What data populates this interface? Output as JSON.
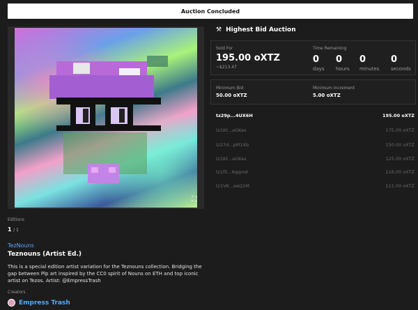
{
  "banner": {
    "label": "Auction Concluded"
  },
  "auction": {
    "title": "Highest Bid Auction",
    "icon": "gavel-icon",
    "sold_label": "Sold For",
    "sold_value": "195.00 oXTZ",
    "sold_usd": "~$213.47",
    "time_label": "Time Remaining",
    "time": [
      {
        "value": "0",
        "unit": "days"
      },
      {
        "value": "0",
        "unit": "hours"
      },
      {
        "value": "0",
        "unit": "minutes"
      },
      {
        "value": "0",
        "unit": "seconds"
      }
    ],
    "min_bid_label": "Minimum Bid",
    "min_bid_value": "50.00 oXTZ",
    "min_inc_label": "Minimum Increment",
    "min_inc_value": "5.00 oXTZ"
  },
  "bids": [
    {
      "address": "tz29p...4UX6H",
      "amount": "195.00 oXTZ"
    },
    {
      "address": "tz1Kt...aGKes",
      "amount": "175.00 oXTZ"
    },
    {
      "address": "tz27d...pM1Xb",
      "amount": "150.00 oXTZ"
    },
    {
      "address": "tz1Kt...aGKes",
      "amount": "125.00 oXTZ"
    },
    {
      "address": "tz1f5...6qqmd",
      "amount": "116.00 oXTZ"
    },
    {
      "address": "tz1VK...eeQ1M",
      "amount": "111.00 oXTZ"
    }
  ],
  "editions": {
    "label": "Editions",
    "current": "1",
    "total": "/ 1"
  },
  "collection": "TezNouns",
  "token_title": "Teznouns (Artist Ed.)",
  "description": "This is a special edition artist variation for the Teznouns collection. Bridging the gap between Plp art inspired by the CC0 spirit of Nouns on ETH and top iconic artist on Tezos. Artist: @EmpressTrash",
  "creators": {
    "label": "Creators",
    "name": "Empress Trash"
  },
  "colors": {
    "accent_link": "#5aa8ff",
    "background": "#1c1c1c"
  }
}
